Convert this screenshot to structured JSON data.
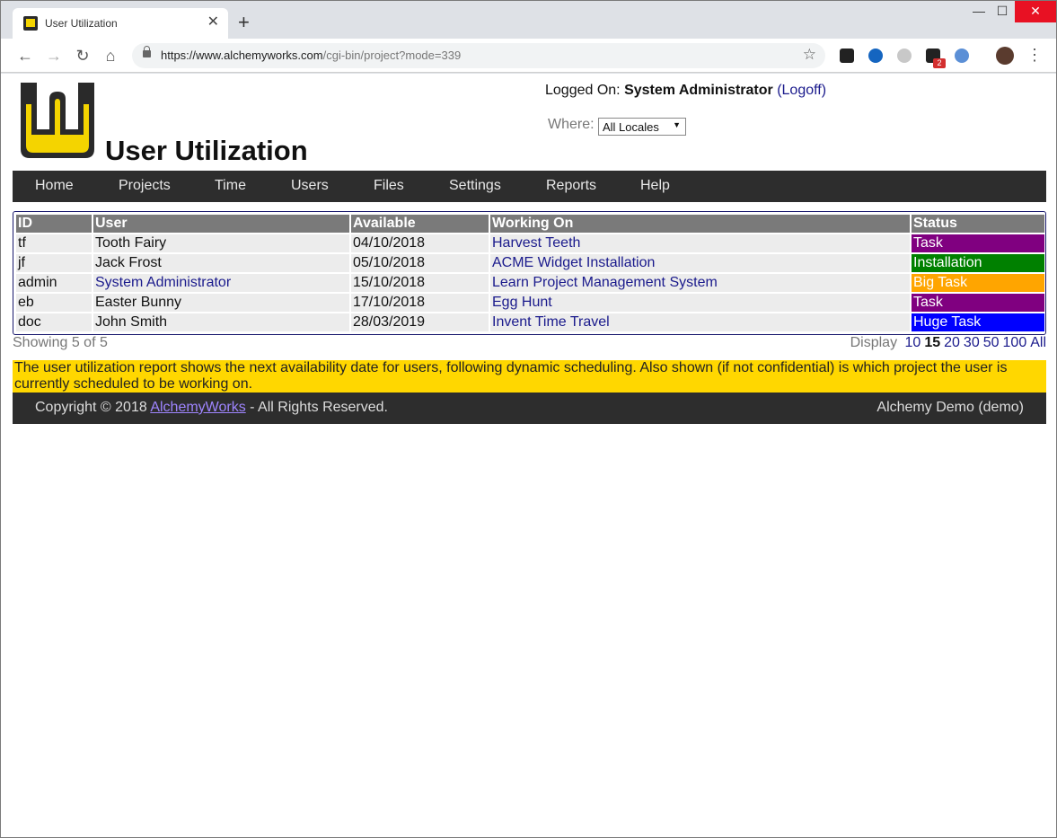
{
  "browser": {
    "tab_title": "User Utilization",
    "tab_close": "✕",
    "new_tab": "+",
    "url_host": "https://www.alchemyworks.com",
    "url_path": "/cgi-bin/project?mode=339",
    "window_min": "—",
    "window_max": "☐",
    "window_close": "✕",
    "back": "←",
    "forward": "→",
    "reload": "↻",
    "home": "⌂",
    "star": "☆",
    "ext_badge": "2",
    "menu": "⋮"
  },
  "header": {
    "title": "User Utilization",
    "logged_on_label": "Logged On:",
    "user_name": "System Administrator",
    "logoff_open": "(",
    "logoff_label": "Logoff",
    "logoff_close": ")",
    "where_label": "Where:",
    "locale_selected": "All Locales"
  },
  "nav": {
    "items": [
      "Home",
      "Projects",
      "Time",
      "Users",
      "Files",
      "Settings",
      "Reports",
      "Help"
    ]
  },
  "table": {
    "headers": [
      "ID",
      "User",
      "Available",
      "Working On",
      "Status"
    ],
    "rows": [
      {
        "id": "tf",
        "user": "Tooth Fairy",
        "available": "04/10/2018",
        "working_on": "Harvest Teeth",
        "status": "Task",
        "status_color": "#800080",
        "user_link": false
      },
      {
        "id": "jf",
        "user": "Jack Frost",
        "available": "05/10/2018",
        "working_on": "ACME Widget Installation",
        "status": "Installation",
        "status_color": "#008000",
        "user_link": false
      },
      {
        "id": "admin",
        "user": "System Administrator",
        "available": "15/10/2018",
        "working_on": "Learn Project Management System",
        "status": "Big Task",
        "status_color": "#ffa500",
        "user_link": true
      },
      {
        "id": "eb",
        "user": "Easter Bunny",
        "available": "17/10/2018",
        "working_on": "Egg Hunt",
        "status": "Task",
        "status_color": "#800080",
        "user_link": false
      },
      {
        "id": "doc",
        "user": "John Smith",
        "available": "28/03/2019",
        "working_on": "Invent Time Travel",
        "status": "Huge Task",
        "status_color": "#0000ff",
        "user_link": false
      }
    ]
  },
  "paging": {
    "showing": "Showing 5 of 5",
    "display_label": "Display",
    "options": [
      "10",
      "15",
      "20",
      "30",
      "50",
      "100",
      "All"
    ],
    "current": "15"
  },
  "info_text": "The user utilization report shows the next availability date for users, following dynamic scheduling. Also shown (if not confidential) is which project the user is currently scheduled to be working on.",
  "footer": {
    "copyright_prefix": "Copyright © 2018",
    "brand": "AlchemyWorks",
    "copyright_suffix": "- All Rights Reserved.",
    "right": "Alchemy Demo (demo)"
  },
  "colors": {
    "nav_bg": "#2d2d2d",
    "info_bg": "#ffd700",
    "link": "#1a1a8c",
    "logo_yellow": "#f4d400"
  },
  "icons": {
    "favicon": "alchemyworks-logo-icon",
    "lock": "lock-icon",
    "star": "bookmark-star-icon",
    "profile": "profile-avatar-icon"
  }
}
